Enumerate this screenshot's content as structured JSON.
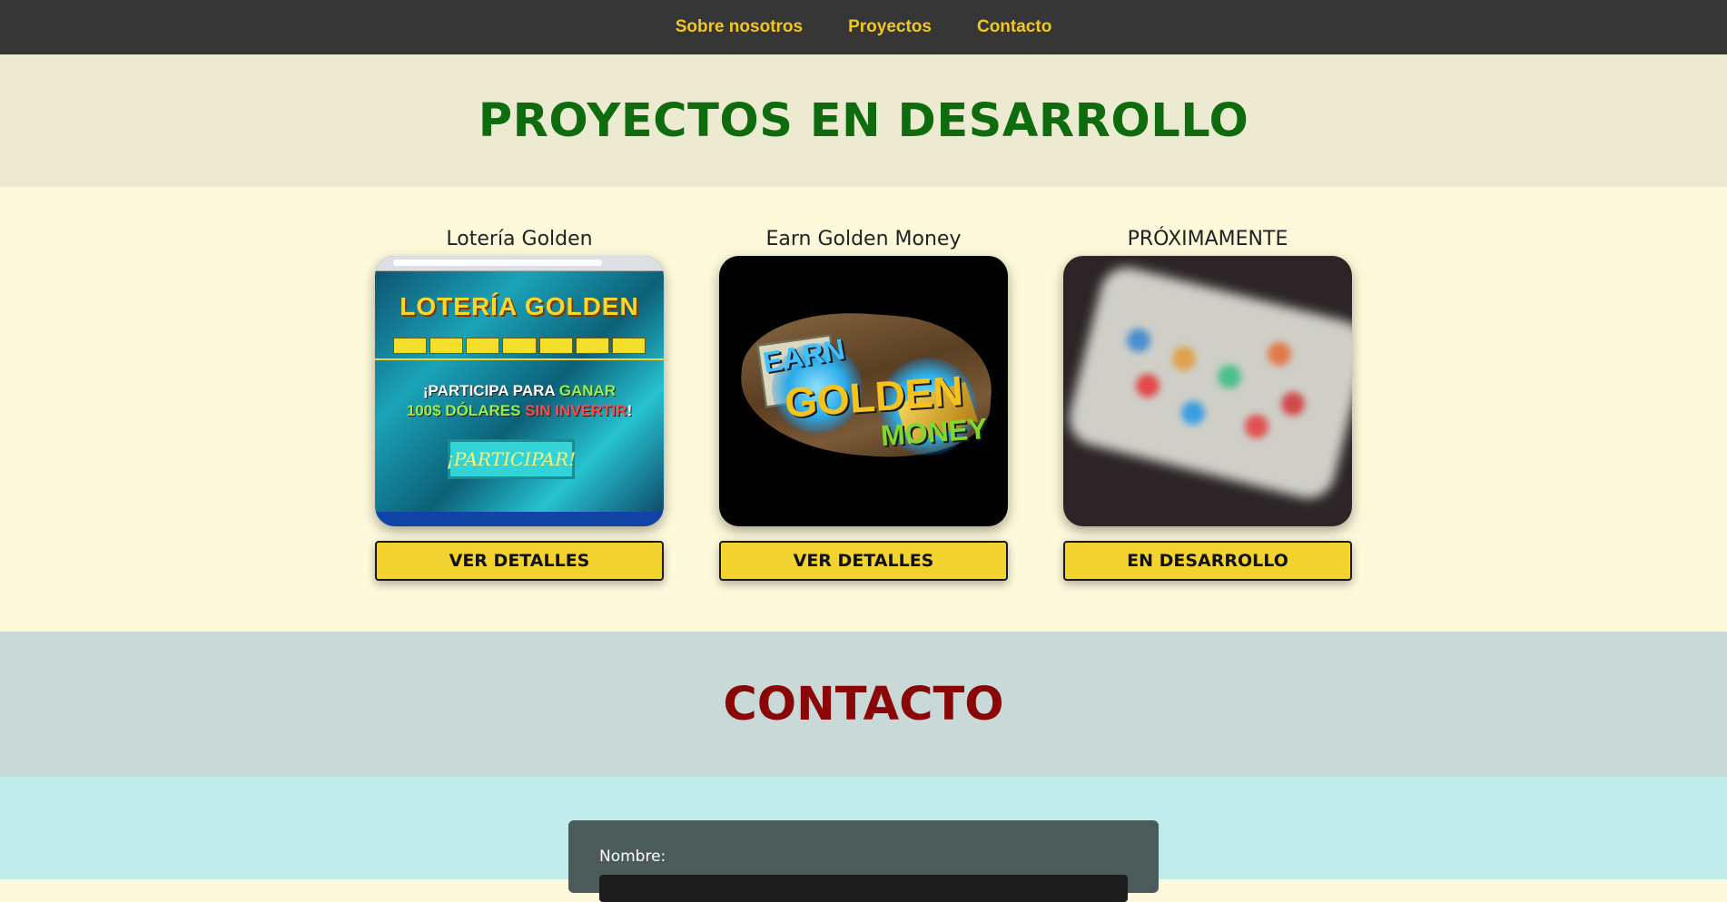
{
  "nav": {
    "items": [
      {
        "label": "Sobre nosotros"
      },
      {
        "label": "Proyectos"
      },
      {
        "label": "Contacto"
      }
    ]
  },
  "proyectos_section": {
    "title": "PROYECTOS EN DESARROLLO"
  },
  "projects": [
    {
      "title": "Lotería Golden",
      "button": "VER DETALLES",
      "image": {
        "heading": "LOTERÍA GOLDEN",
        "slogan_line1_a": "¡PARTICIPA PARA ",
        "slogan_line1_b": "GANAR",
        "slogan_line2_a": "100$ DÓLARES ",
        "slogan_line2_b": "SIN INVERTIR",
        "slogan_line2_c": "!",
        "cta": "¡PARTICIPAR!"
      }
    },
    {
      "title": "Earn Golden Money",
      "button": "VER DETALLES",
      "image": {
        "word1": "EARN",
        "word2": "GOLDEN",
        "word3": "MONEY"
      }
    },
    {
      "title": "PRÓXIMAMENTE",
      "button": "EN DESARROLLO"
    }
  ],
  "contact_section": {
    "title": "CONTACTO"
  },
  "contact_form": {
    "name_label": "Nombre:"
  }
}
